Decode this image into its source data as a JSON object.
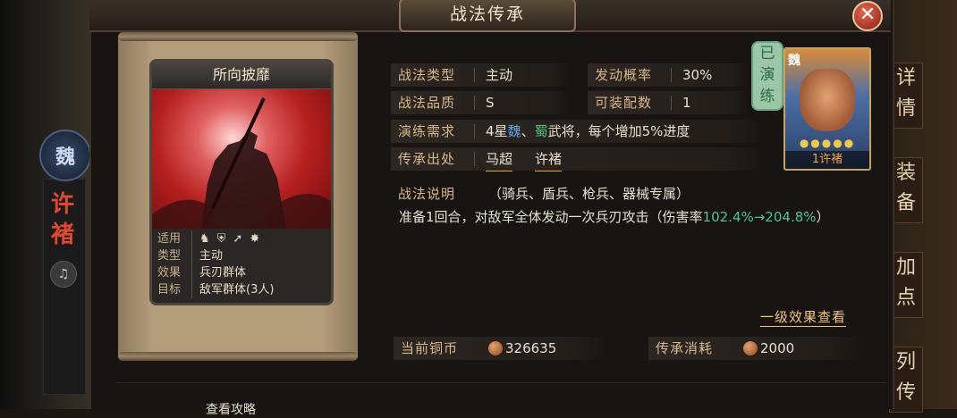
{
  "window": {
    "title": "战法传承",
    "close_glyph": "✕"
  },
  "background": {
    "faction_emblem": "魏",
    "side_name": "许褚",
    "sound_icon": "speaker-icon",
    "right_tabs": [
      "详情",
      "装备",
      "加点",
      "列传"
    ]
  },
  "card": {
    "title": "所向披靡",
    "rows": {
      "apply_label": "适用",
      "apply_icons": [
        "cavalry-icon",
        "shield-icon",
        "spear-icon",
        "siege-icon"
      ],
      "type_label": "类型",
      "type_value": "主动",
      "effect_label": "效果",
      "effect_value": "兵刃群体",
      "target_label": "目标",
      "target_value": "敌军群体(3人)"
    }
  },
  "fields": {
    "tactic_type_label": "战法类型",
    "tactic_type_value": "主动",
    "trigger_label": "发动概率",
    "trigger_value": "30%",
    "quality_label": "战法品质",
    "quality_value": "S",
    "slots_label": "可装配数",
    "slots_value": "1",
    "drill_label": "演练需求",
    "drill_prefix": "4星",
    "drill_wei": "魏",
    "drill_sep": "、",
    "drill_shu": "蜀",
    "drill_suffix": "武将，每个增加5%进度",
    "source_label": "传承出处",
    "source_1": "马超",
    "source_2": "许褚"
  },
  "description": {
    "label": "战法说明",
    "subtitle": "（骑兵、盾兵、枪兵、器械专属）",
    "text_main": "准备1回合，对敌军全体发动一次兵刃攻击（伤害率",
    "text_value": "102.4%→204.8%",
    "text_end": "）",
    "link": "一级效果查看"
  },
  "costs": {
    "copper_label": "当前铜币",
    "copper_value": "326635",
    "cost_label": "传承消耗",
    "cost_value": "2000"
  },
  "portrait": {
    "faction": "魏",
    "stars": "●●●●●",
    "name": "1许褚",
    "seal": "已演练"
  },
  "bottom": {
    "tip": "查看攻略"
  }
}
